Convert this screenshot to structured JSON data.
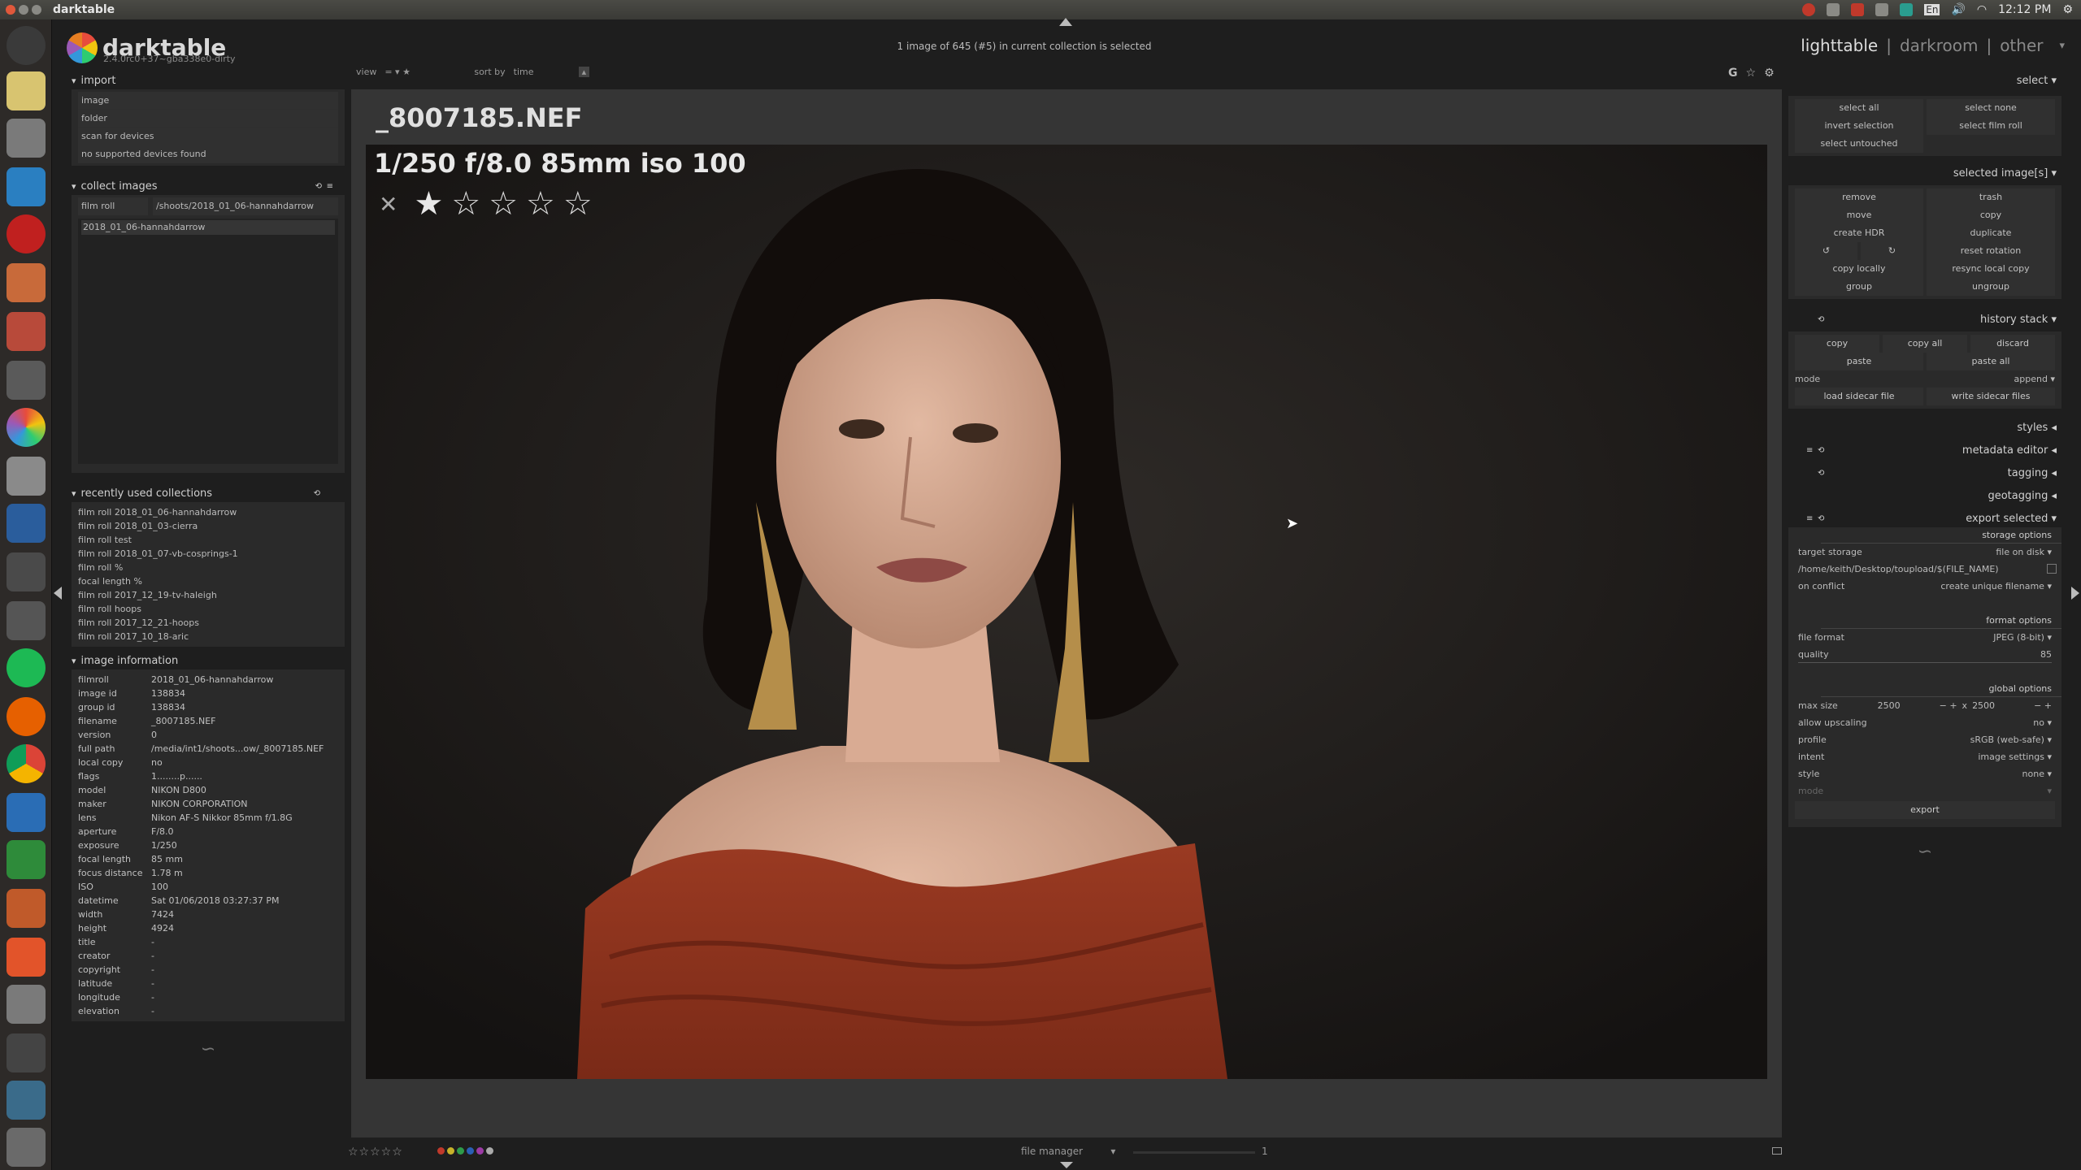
{
  "window": {
    "title": "darktable"
  },
  "tray": {
    "clock": "12:12 PM",
    "lang": "En"
  },
  "app": {
    "name": "darktable",
    "version": "2.4.0rc0+37~gba338e0-dirty"
  },
  "collection_info": "1 image of 645 (#5) in current collection is selected",
  "views": {
    "lightable": "lighttable",
    "sep": "|",
    "darkroom": "darkroom",
    "other": "other"
  },
  "filter": {
    "view_label": "view",
    "view_value": "= ▾  ★",
    "sort_label": "sort by",
    "sort_value": "time"
  },
  "import": {
    "title": "import",
    "buttons": [
      "image",
      "folder",
      "scan for devices",
      "no supported devices found"
    ]
  },
  "collect": {
    "title": "collect images",
    "type": "film roll",
    "path": "/shoots/2018_01_06-hannahdarrow",
    "item": "2018_01_06-hannahdarrow"
  },
  "recent": {
    "title": "recently used collections",
    "items": [
      "film roll 2018_01_06-hannahdarrow",
      "film roll 2018_01_03-cierra",
      "film roll test",
      "film roll 2018_01_07-vb-cosprings-1",
      "film roll %",
      "focal length %",
      "film roll 2017_12_19-tv-haleigh",
      "film roll hoops",
      "film roll 2017_12_21-hoops",
      "film roll 2017_10_18-aric"
    ]
  },
  "image_info": {
    "title": "image information",
    "rows": [
      [
        "filmroll",
        "2018_01_06-hannahdarrow"
      ],
      [
        "image id",
        "138834"
      ],
      [
        "group id",
        "138834"
      ],
      [
        "filename",
        "_8007185.NEF"
      ],
      [
        "version",
        "0"
      ],
      [
        "full path",
        "/media/int1/shoots...ow/_8007185.NEF"
      ],
      [
        "local copy",
        "no"
      ],
      [
        "flags",
        "1........p......"
      ],
      [
        "model",
        "NIKON D800"
      ],
      [
        "maker",
        "NIKON CORPORATION"
      ],
      [
        "lens",
        "Nikon AF-S Nikkor 85mm f/1.8G"
      ],
      [
        "aperture",
        "F/8.0"
      ],
      [
        "exposure",
        "1/250"
      ],
      [
        "focal length",
        "85 mm"
      ],
      [
        "focus distance",
        "1.78 m"
      ],
      [
        "ISO",
        "100"
      ],
      [
        "datetime",
        "Sat 01/06/2018 03:27:37 PM"
      ],
      [
        "width",
        "7424"
      ],
      [
        "height",
        "4924"
      ],
      [
        "title",
        "-"
      ],
      [
        "creator",
        "-"
      ],
      [
        "copyright",
        "-"
      ],
      [
        "latitude",
        "-"
      ],
      [
        "longitude",
        "-"
      ],
      [
        "elevation",
        "-"
      ]
    ]
  },
  "preview": {
    "filename": "_8007185.NEF",
    "exif": "1/250 f/8.0 85mm iso 100",
    "reject": "✕",
    "rating": 1
  },
  "select": {
    "title": "select",
    "buttons": [
      "select all",
      "select none",
      "invert selection",
      "select film roll",
      "select untouched"
    ]
  },
  "selected": {
    "title": "selected image[s]",
    "buttons": [
      "remove",
      "trash",
      "move",
      "copy",
      "create HDR",
      "duplicate",
      "↺",
      "↻",
      "reset rotation",
      "copy locally",
      "resync local copy",
      "group",
      "ungroup"
    ]
  },
  "history": {
    "title": "history stack",
    "buttons": [
      "copy",
      "copy all",
      "discard",
      "paste",
      "paste all"
    ],
    "mode_label": "mode",
    "mode_value": "append",
    "load": "load sidecar file",
    "write": "write sidecar files"
  },
  "modules": [
    "styles",
    "metadata editor",
    "tagging",
    "geotagging"
  ],
  "export": {
    "title": "export selected",
    "storage_hdr": "storage options",
    "target_label": "target storage",
    "target_value": "file on disk",
    "path": "/home/keith/Desktop/toupload/$(FILE_NAME)",
    "conflict_label": "on conflict",
    "conflict_value": "create unique filename",
    "format_hdr": "format options",
    "format_label": "file format",
    "format_value": "JPEG (8-bit)",
    "quality_label": "quality",
    "quality_value": "85",
    "global_hdr": "global options",
    "maxsize_label": "max size",
    "max_w": "2500",
    "max_h": "2500",
    "x": "x",
    "upscale_label": "allow upscaling",
    "upscale_value": "no",
    "profile_label": "profile",
    "profile_value": "sRGB (web-safe)",
    "intent_label": "intent",
    "intent_value": "image settings",
    "style_label": "style",
    "style_value": "none",
    "mode_label": "mode",
    "button": "export"
  },
  "bottom": {
    "layout": "file manager",
    "zoom": "1",
    "stars": "☆☆☆☆☆"
  },
  "colors": {
    "accent": "#d8d8d8",
    "bg": "#1e1e1e",
    "panel": "#2a2a2a"
  }
}
